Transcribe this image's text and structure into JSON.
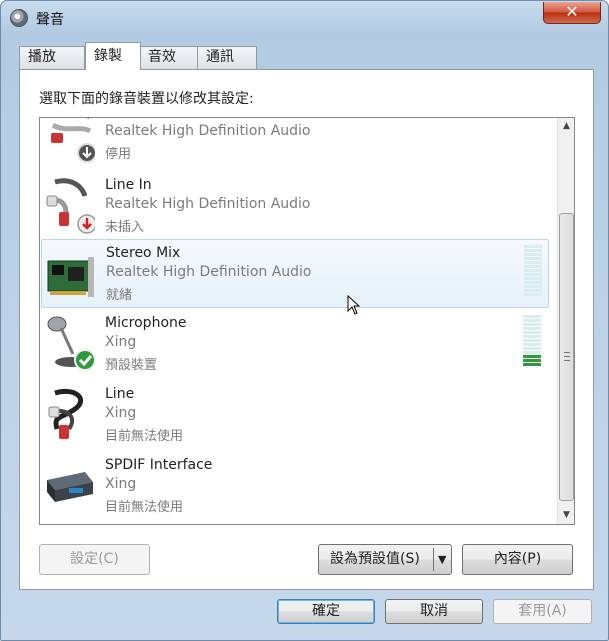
{
  "window": {
    "title": "聲音",
    "close_glyph": "✕"
  },
  "tabs": [
    {
      "label": "播放",
      "active": false
    },
    {
      "label": "錄製",
      "active": true
    },
    {
      "label": "音效",
      "active": false
    },
    {
      "label": "通訊",
      "active": false
    }
  ],
  "panel": {
    "instruction": "選取下面的錄音裝置以修改其設定:"
  },
  "devices": [
    {
      "name": "",
      "sub": "Realtek High Definition Audio",
      "status": "停用",
      "icon": "line-jack-disabled-icon"
    },
    {
      "name": "Line In",
      "sub": "Realtek High Definition Audio",
      "status": "未插入",
      "icon": "line-jack-unplugged-icon"
    },
    {
      "name": "Stereo Mix",
      "sub": "Realtek High Definition Audio",
      "status": "就緒",
      "icon": "sound-card-icon",
      "selected": true,
      "level": 0
    },
    {
      "name": "Microphone",
      "sub": "Xing",
      "status": "預設裝置",
      "icon": "microphone-default-icon",
      "level": 0.2
    },
    {
      "name": "Line",
      "sub": "Xing",
      "status": "目前無法使用",
      "icon": "line-jack-icon"
    },
    {
      "name": "SPDIF Interface",
      "sub": "Xing",
      "status": "目前無法使用",
      "icon": "spdif-device-icon"
    }
  ],
  "buttons": {
    "configure": "設定(C)",
    "set_default": "設為預設值(S)",
    "properties": "內容(P)",
    "ok": "確定",
    "cancel": "取消",
    "apply": "套用(A)"
  },
  "scrollbar": {
    "up": "▲",
    "down": "▼"
  }
}
